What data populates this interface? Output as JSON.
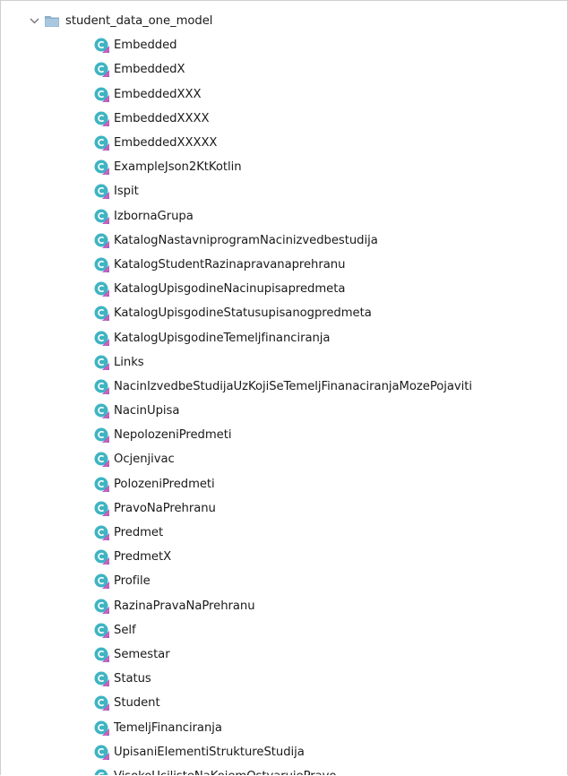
{
  "tree": {
    "folder": {
      "label": "student_data_one_model",
      "expanded": true,
      "chevron_icon": "chevron-down-icon",
      "icon": "folder-icon"
    },
    "class_icon": "kotlin-class-icon",
    "colors": {
      "class_icon_circle": "#3fb4c2",
      "class_icon_accent": "#a55ed6",
      "folder": "#8fb6d4",
      "text": "#1a1a1a"
    },
    "items": [
      {
        "label": "Embedded"
      },
      {
        "label": "EmbeddedX"
      },
      {
        "label": "EmbeddedXXX"
      },
      {
        "label": "EmbeddedXXXX"
      },
      {
        "label": "EmbeddedXXXXX"
      },
      {
        "label": "ExampleJson2KtKotlin"
      },
      {
        "label": "Ispit"
      },
      {
        "label": "IzbornaGrupa"
      },
      {
        "label": "KatalogNastavniprogramNacinizvedbestudija"
      },
      {
        "label": "KatalogStudentRazinapravanaprehranu"
      },
      {
        "label": "KatalogUpisgodineNacinupisapredmeta"
      },
      {
        "label": "KatalogUpisgodineStatusupisanogpredmeta"
      },
      {
        "label": "KatalogUpisgodineTemeljfinanciranja"
      },
      {
        "label": "Links"
      },
      {
        "label": "NacinIzvedbeStudijaUzKojiSeTemeljFinanaciranjaMozePojaviti"
      },
      {
        "label": "NacinUpisa"
      },
      {
        "label": "NepolozeniPredmeti"
      },
      {
        "label": "Ocjenjivac"
      },
      {
        "label": "PolozeniPredmeti"
      },
      {
        "label": "PravoNaPrehranu"
      },
      {
        "label": "Predmet"
      },
      {
        "label": "PredmetX"
      },
      {
        "label": "Profile"
      },
      {
        "label": "RazinaPravaNaPrehranu"
      },
      {
        "label": "Self"
      },
      {
        "label": "Semestar"
      },
      {
        "label": "Status"
      },
      {
        "label": "Student"
      },
      {
        "label": "TemeljFinanciranja"
      },
      {
        "label": "UpisaniElementiStruktureStudija"
      },
      {
        "label": "VisokoUcilisteNaKojemOstvarujePravo"
      }
    ]
  }
}
